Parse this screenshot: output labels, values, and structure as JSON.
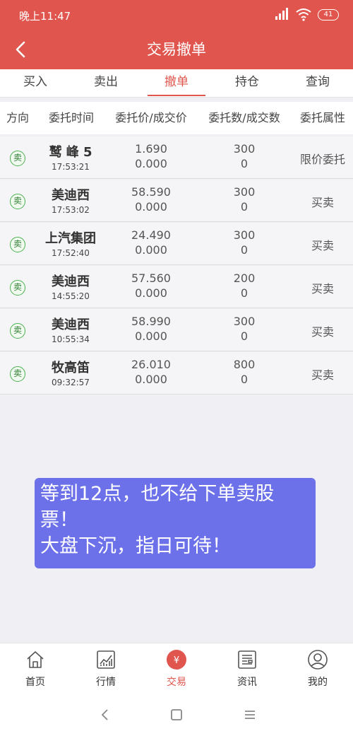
{
  "status": {
    "time": "晚上11:47",
    "battery": "41"
  },
  "nav": {
    "title": "交易撤单",
    "back_label": "<"
  },
  "tabs": [
    {
      "label": "买入"
    },
    {
      "label": "卖出"
    },
    {
      "label": "撤单"
    },
    {
      "label": "持仓"
    },
    {
      "label": "查询"
    }
  ],
  "active_tab": "撤单",
  "table": {
    "headers": [
      "方向",
      "委托时间",
      "委托价/成交价",
      "委托数/成交数",
      "委托属性"
    ],
    "rows": [
      {
        "dir": "卖",
        "name": "鹫 峰 5",
        "time": "17:53:21",
        "price": "1.690",
        "deal_price": "0.000",
        "qty": "300",
        "deal_qty": "0",
        "attr": "限价委托"
      },
      {
        "dir": "卖",
        "name": "美迪西",
        "time": "17:53:02",
        "price": "58.590",
        "deal_price": "0.000",
        "qty": "300",
        "deal_qty": "0",
        "attr": "买卖"
      },
      {
        "dir": "卖",
        "name": "上汽集团",
        "time": "17:52:40",
        "price": "24.490",
        "deal_price": "0.000",
        "qty": "300",
        "deal_qty": "0",
        "attr": "买卖"
      },
      {
        "dir": "卖",
        "name": "美迪西",
        "time": "14:55:20",
        "price": "57.560",
        "deal_price": "0.000",
        "qty": "200",
        "deal_qty": "0",
        "attr": "买卖"
      },
      {
        "dir": "卖",
        "name": "美迪西",
        "time": "10:55:34",
        "price": "58.990",
        "deal_price": "0.000",
        "qty": "300",
        "deal_qty": "0",
        "attr": "买卖"
      },
      {
        "dir": "卖",
        "name": "牧高笛",
        "time": "09:32:57",
        "price": "26.010",
        "deal_price": "0.000",
        "qty": "800",
        "deal_qty": "0",
        "attr": "买卖"
      }
    ]
  },
  "bubble": {
    "line1": "等到12点，也不给下单卖股",
    "line2": "票！",
    "line3": "大盘下沉，指日可待！"
  },
  "bottom_nav": [
    {
      "label": "首页",
      "icon": "home-icon"
    },
    {
      "label": "行情",
      "icon": "chart-icon"
    },
    {
      "label": "交易",
      "icon": "yen-icon",
      "glyph": "¥"
    },
    {
      "label": "资讯",
      "icon": "news-icon"
    },
    {
      "label": "我的",
      "icon": "user-icon"
    }
  ],
  "colors": {
    "brand": "#e0564e",
    "bubble": "#6c71ea",
    "sell": "#4caf50"
  }
}
